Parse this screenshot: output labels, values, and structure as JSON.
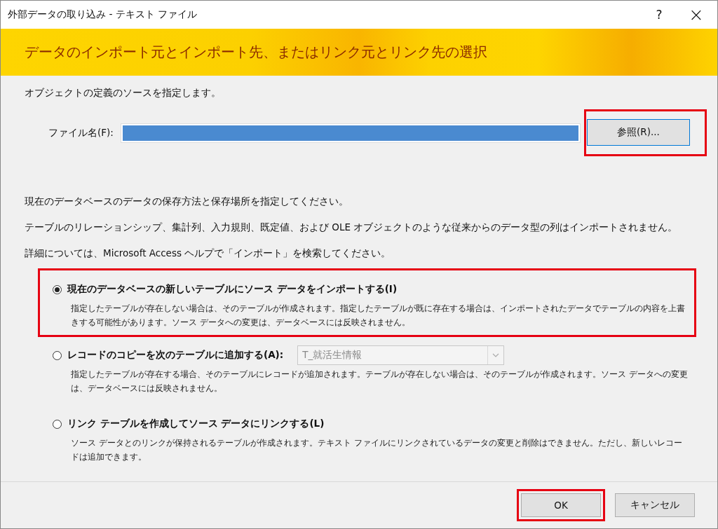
{
  "window": {
    "title": "外部データの取り込み - テキスト ファイル",
    "help_button": "?",
    "close_button": "×"
  },
  "banner": {
    "title": "データのインポート元とインポート先、またはリンク元とリンク先の選択"
  },
  "source": {
    "instruction": "オブジェクトの定義のソースを指定します。",
    "file_label": "ファイル名(F):",
    "browse_button": {
      "label": "参照(R)...",
      "highlighted": true
    }
  },
  "paragraphs": [
    "現在のデータベースのデータの保存方法と保存場所を指定してください。",
    "テーブルのリレーションシップ、集計列、入力規則、既定値、および OLE オブジェクトのような従来からのデータ型の列はインポートされません。",
    "詳細については、Microsoft Access ヘルプで「インポート」を検索してください。"
  ],
  "options": [
    {
      "label": "現在のデータベースの新しいテーブルにソース データをインポートする(I)",
      "selected": true,
      "highlighted": true,
      "description": "指定したテーブルが存在しない場合は、そのテーブルが作成されます。指定したテーブルが既に存在する場合は、インポートされたデータでテーブルの内容を上書きする可能性があります。ソース データへの変更は、データベースには反映されません。"
    },
    {
      "label": "レコードのコピーを次のテーブルに追加する(A):",
      "selected": false,
      "highlighted": false,
      "combo": {
        "value": "T_就活生情報",
        "disabled": true
      },
      "description": "指定したテーブルが存在する場合、そのテーブルにレコードが追加されます。テーブルが存在しない場合は、そのテーブルが作成されます。ソース データへの変更は、データベースには反映されません。"
    },
    {
      "label": "リンク テーブルを作成してソース データにリンクする(L)",
      "selected": false,
      "highlighted": false,
      "description": "ソース データとのリンクが保持されるテーブルが作成されます。テキスト ファイルにリンクされているデータの変更と削除はできません。ただし、新しいレコードは追加できます。"
    }
  ],
  "buttons": [
    {
      "label": "OK",
      "highlighted": true
    },
    {
      "label": "キャンセル",
      "highlighted": false
    }
  ]
}
